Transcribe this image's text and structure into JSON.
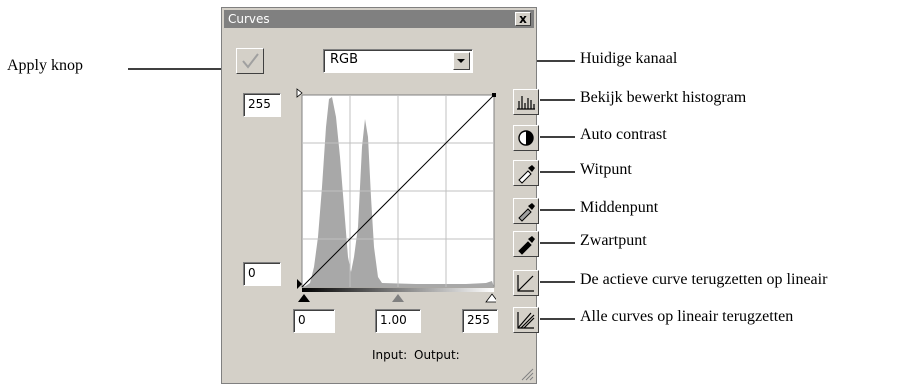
{
  "window": {
    "title": "Curves",
    "close_label": "x"
  },
  "channel": {
    "value": "RGB"
  },
  "fields": {
    "output_max": "255",
    "output_min": "0",
    "input_black": "0",
    "input_gamma": "1.00",
    "input_white": "255"
  },
  "axis_labels": {
    "input": "Input:",
    "output": "Output:"
  },
  "annotations": {
    "apply": "Apply knop",
    "channel": "Huidige kanaal",
    "histogram": "Bekijk bewerkt histogram",
    "auto_contrast": "Auto contrast",
    "white_point": "Witpunt",
    "mid_point": "Middenpunt",
    "black_point": "Zwartpunt",
    "reset_curve": "De actieve curve terugzetten op lineair",
    "reset_all": "Alle curves op lineair terugzetten"
  },
  "icons": [
    "checkmark-icon",
    "dropdown-arrow-icon",
    "histogram-icon",
    "contrast-icon",
    "eyedropper-white-icon",
    "eyedropper-gray-icon",
    "eyedropper-black-icon",
    "reset-curve-icon",
    "reset-all-curves-icon"
  ],
  "colors": {
    "window_bg": "#d4d0c8",
    "title_bar": "#808080",
    "histogram": "#a8a8a8"
  }
}
